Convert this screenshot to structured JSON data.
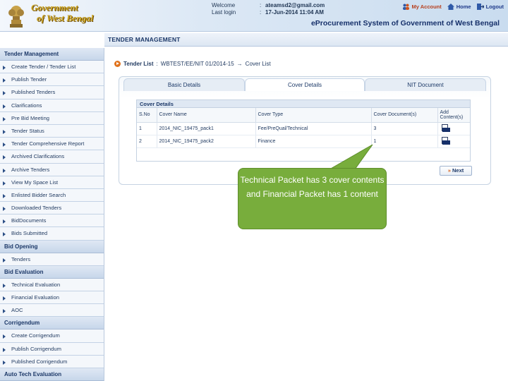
{
  "header": {
    "org_line1": "Government",
    "org_line2": "of West Bengal",
    "welcome_label": "Welcome",
    "welcome_value": "ateamsd2@gmail.com",
    "lastlogin_label": "Last login",
    "lastlogin_value": "17-Jun-2014 11:04 AM",
    "colon": ":",
    "my_account": "My Account",
    "home": "Home",
    "logout": "Logout",
    "portal_title": "eProcurement System of Government of West Bengal"
  },
  "sidebar": {
    "section_tender": "Tender Management",
    "tender_items": [
      "Create Tender / Tender List",
      "Publish Tender",
      "Published Tenders",
      "Clarifications",
      "Pre Bid Meeting",
      "Tender Status",
      "Tender Comprehensive Report",
      "Archived Clarifications",
      "Archive Tenders",
      "View My Space List",
      "Enlisted Bidder Search",
      "Downloaded Tenders",
      "BidDocuments",
      "Bids Submitted"
    ],
    "section_bid_opening": "Bid Opening",
    "bid_opening_items": [
      "Tenders"
    ],
    "section_bid_eval": "Bid Evaluation",
    "bid_eval_items": [
      "Technical Evaluation",
      "Financial Evaluation",
      "AOC"
    ],
    "section_corrigendum": "Corrigendum",
    "corrigendum_items": [
      "Create Corrigendum",
      "Publish Corrigendum",
      "Published Corrigendum"
    ],
    "section_auto_tech": "Auto Tech Evaluation"
  },
  "main": {
    "page_header": "TENDER MANAGEMENT",
    "breadcrumb_root": "Tender List",
    "breadcrumb_sep": ":",
    "breadcrumb_ref": "WBTEST/EE/NIT 01/2014-15",
    "breadcrumb_arrow": "→",
    "breadcrumb_leaf": "Cover List",
    "tabs": [
      {
        "label": "Basic Details"
      },
      {
        "label": "Cover Details"
      },
      {
        "label": "NIT Document"
      }
    ],
    "active_tab": "Cover Details",
    "cover_details_title": "Cover Details",
    "columns": [
      "S.No",
      "Cover Name",
      "Cover Type",
      "Cover Document(s)",
      "Add Content(s)"
    ],
    "rows": [
      {
        "sno": "1",
        "name": "2014_NIC_19475_pack1",
        "type": "Fee/PreQual/Technical",
        "docs": "3"
      },
      {
        "sno": "2",
        "name": "2014_NIC_19475_pack2",
        "type": "Finance",
        "docs": "1"
      }
    ],
    "next_arrow": "»",
    "next_label": "Next"
  },
  "callout": {
    "text": "Technical Packet has 3 cover contents and Financial Packet has 1 content",
    "color": "#78ad3c"
  },
  "colors": {
    "nav_head_bg": "#c7d7ea",
    "accent_orange": "#e0731d",
    "text_navy": "#1c3868"
  }
}
